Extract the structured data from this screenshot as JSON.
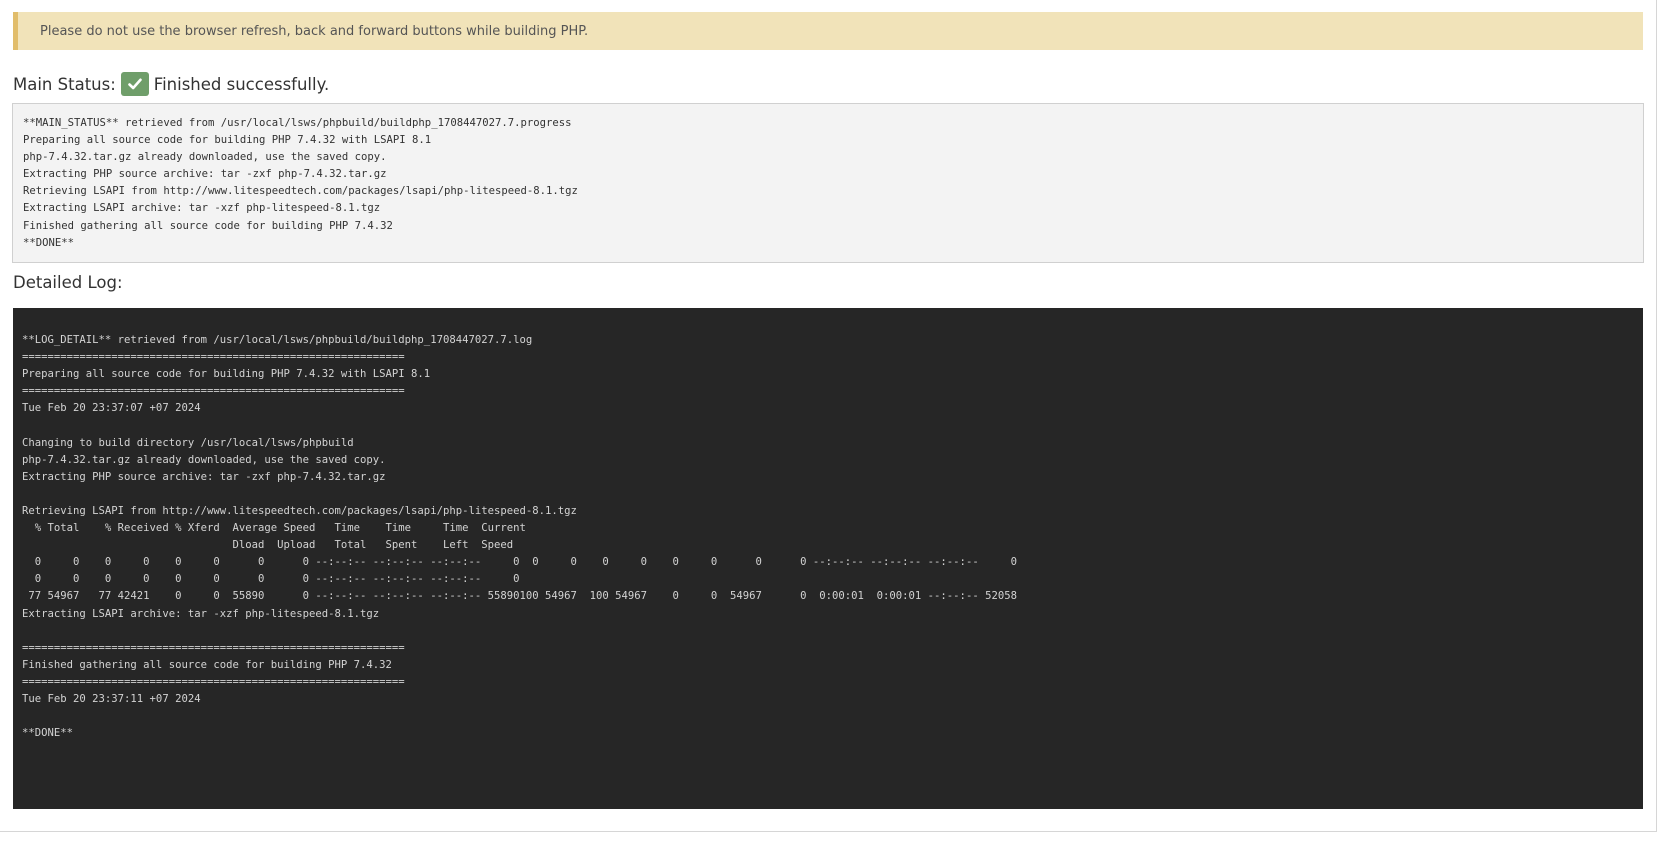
{
  "warning": {
    "text": "Please do not use the browser refresh, back and forward buttons while building PHP."
  },
  "main_status": {
    "label": "Main Status:",
    "icon": "check-icon",
    "result": "Finished successfully.",
    "badge_color": "#6f9e6a"
  },
  "status_log": [
    "**MAIN_STATUS** retrieved from /usr/local/lsws/phpbuild/buildphp_1708447027.7.progress",
    "Preparing all source code for building PHP 7.4.32 with LSAPI 8.1",
    "php-7.4.32.tar.gz already downloaded, use the saved copy.",
    "Extracting PHP source archive: tar -zxf php-7.4.32.tar.gz",
    "Retrieving LSAPI from http://www.litespeedtech.com/packages/lsapi/php-litespeed-8.1.tgz",
    "Extracting LSAPI archive: tar -xzf php-litespeed-8.1.tgz",
    "Finished gathering all source code for building PHP 7.4.32",
    "**DONE**"
  ],
  "detailed_log": {
    "heading": "Detailed Log:",
    "lines": [
      "**LOG_DETAIL** retrieved from /usr/local/lsws/phpbuild/buildphp_1708447027.7.log",
      "============================================================",
      "Preparing all source code for building PHP 7.4.32 with LSAPI 8.1",
      "============================================================",
      "Tue Feb 20 23:37:07 +07 2024",
      "",
      "Changing to build directory /usr/local/lsws/phpbuild",
      "php-7.4.32.tar.gz already downloaded, use the saved copy.",
      "Extracting PHP source archive: tar -zxf php-7.4.32.tar.gz",
      "",
      "Retrieving LSAPI from http://www.litespeedtech.com/packages/lsapi/php-litespeed-8.1.tgz",
      "  % Total    % Received % Xferd  Average Speed   Time    Time     Time  Current",
      "                                 Dload  Upload   Total   Spent    Left  Speed",
      "  0     0    0     0    0     0      0      0 --:--:-- --:--:-- --:--:--     0  0     0    0     0    0     0      0      0 --:--:-- --:--:-- --:--:--     0",
      "  0     0    0     0    0     0      0      0 --:--:-- --:--:-- --:--:--     0",
      " 77 54967   77 42421    0     0  55890      0 --:--:-- --:--:-- --:--:-- 55890100 54967  100 54967    0     0  54967      0  0:00:01  0:00:01 --:--:-- 52058",
      "Extracting LSAPI archive: tar -xzf php-litespeed-8.1.tgz",
      "",
      "============================================================",
      "Finished gathering all source code for building PHP 7.4.32",
      "============================================================",
      "Tue Feb 20 23:37:11 +07 2024",
      "",
      "**DONE**"
    ]
  },
  "colors": {
    "warning_bg": "#f1e3b9",
    "warning_border": "#e1bd6b",
    "log_bg": "#262626",
    "status_box_bg": "#f3f3f3"
  }
}
